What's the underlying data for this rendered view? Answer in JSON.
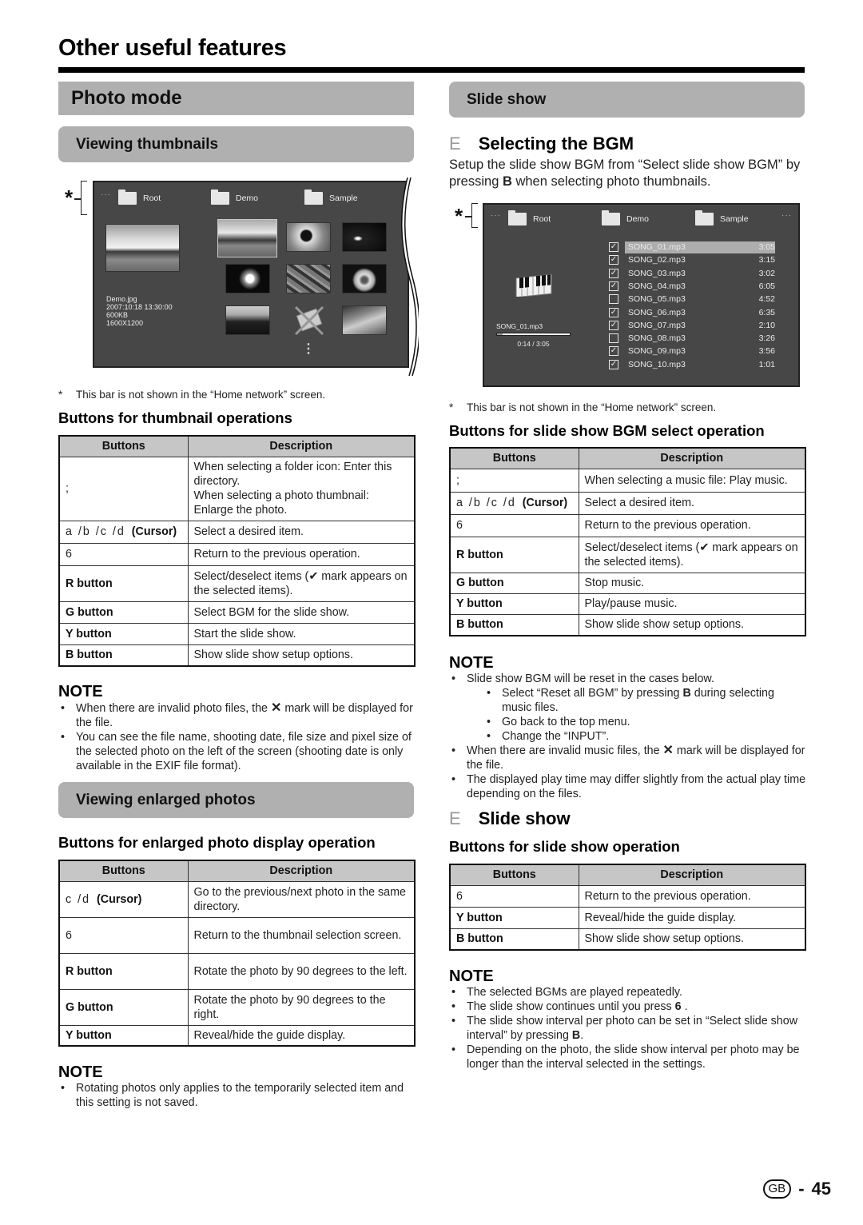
{
  "page": {
    "title": "Other useful features",
    "footer": {
      "region_badge": "GB",
      "separator": "-",
      "page_number": "45"
    }
  },
  "left": {
    "section_title": "Photo mode",
    "thumbnails": {
      "bar_title": "Viewing thumbnails",
      "bracket_mark": "*",
      "screen": {
        "more_indicator": "···",
        "folders": [
          "Root",
          "Demo",
          "Sample"
        ],
        "selected_photo": {
          "file_name": "Demo.jpg",
          "date": "2007:10:18 13:30:00",
          "size": "600KB",
          "pixels": "1600X1200"
        },
        "thumbnails": [
          "landscape",
          "flower-closeup",
          "sunset",
          "daisies",
          "leaves",
          "dandelion",
          "treeline",
          "invalid-file",
          "insect"
        ],
        "scroll_indicator": "⋮"
      },
      "footnote_mark": "*",
      "footnote": "This bar is not shown in the “Home network” screen.",
      "table_heading": "Buttons for thumbnail operations",
      "table": {
        "headers": [
          "Buttons",
          "Description"
        ],
        "rows": [
          {
            "button": ";",
            "button_bold": "",
            "description": "When selecting a folder icon: Enter this directory.\nWhen selecting a photo thumbnail: Enlarge the photo."
          },
          {
            "button": "a /b /c /d",
            "button_bold": "(Cursor)",
            "description": "Select a desired item."
          },
          {
            "button": "6",
            "button_bold": "",
            "description": "Return to the previous operation."
          },
          {
            "button": "",
            "button_bold": "R button",
            "description": "Select/deselect items (✔ mark appears on the selected items)."
          },
          {
            "button": "",
            "button_bold": "G button",
            "description": "Select BGM for the slide show."
          },
          {
            "button": "",
            "button_bold": "Y button",
            "description": "Start the slide show."
          },
          {
            "button": "",
            "button_bold": "B button",
            "description": "Show slide show setup options."
          }
        ]
      },
      "note": {
        "title": "NOTE",
        "items": [
          {
            "before": "When there are invalid photo files, the ",
            "mark": "✕",
            "after": " mark will be displayed for the file."
          },
          {
            "before": "You can see the file name, shooting date, file size and pixel size of the selected photo on the left of the screen (shooting date is only available in the EXIF file format).",
            "mark": "",
            "after": ""
          }
        ]
      }
    },
    "enlarged": {
      "bar_title": "Viewing enlarged photos",
      "table_heading": "Buttons for enlarged photo display operation",
      "table": {
        "headers": [
          "Buttons",
          "Description"
        ],
        "rows": [
          {
            "button": "c /d",
            "button_bold": "(Cursor)",
            "description": "Go to the previous/next photo in the same directory."
          },
          {
            "button": "6",
            "button_bold": "",
            "description": "Return to the thumbnail selection screen."
          },
          {
            "button": "",
            "button_bold": "R button",
            "description": "Rotate the photo by 90 degrees to the left."
          },
          {
            "button": "",
            "button_bold": "G button",
            "description": "Rotate the photo by 90 degrees to the right."
          },
          {
            "button": "",
            "button_bold": "Y button",
            "description": "Reveal/hide the guide display."
          }
        ]
      },
      "note": {
        "title": "NOTE",
        "items": [
          {
            "text": "Rotating photos only applies to the temporarily selected item and this setting is not saved."
          }
        ]
      }
    }
  },
  "right": {
    "section_title": "Slide show",
    "bgm": {
      "marker": "E",
      "heading": "Selecting the BGM",
      "intro_before": "Setup the slide show BGM from “Select slide show BGM” by pressing ",
      "intro_key": "B",
      "intro_after": " when selecting photo thumbnails.",
      "bracket_mark": "*",
      "screen": {
        "more_indicator_left": "···",
        "more_indicator_right": "···",
        "folders": [
          "Root",
          "Demo",
          "Sample"
        ],
        "now_playing": "SONG_01.mp3",
        "progress": {
          "elapsed": "0:14",
          "total": "3:05",
          "label": "0:14 / 3:05",
          "fraction": 0.076
        },
        "songs": [
          {
            "name": "SONG_01.mp3",
            "time": "3:05",
            "checked": true,
            "selected": true
          },
          {
            "name": "SONG_02.mp3",
            "time": "3:15",
            "checked": true,
            "selected": false
          },
          {
            "name": "SONG_03.mp3",
            "time": "3:02",
            "checked": true,
            "selected": false
          },
          {
            "name": "SONG_04.mp3",
            "time": "6:05",
            "checked": true,
            "selected": false
          },
          {
            "name": "SONG_05.mp3",
            "time": "4:52",
            "checked": false,
            "selected": false
          },
          {
            "name": "SONG_06.mp3",
            "time": "6:35",
            "checked": true,
            "selected": false
          },
          {
            "name": "SONG_07.mp3",
            "time": "2:10",
            "checked": true,
            "selected": false
          },
          {
            "name": "SONG_08.mp3",
            "time": "3:26",
            "checked": false,
            "selected": false
          },
          {
            "name": "SONG_09.mp3",
            "time": "3:56",
            "checked": true,
            "selected": false
          },
          {
            "name": "SONG_10.mp3",
            "time": "1:01",
            "checked": true,
            "selected": false
          }
        ],
        "check_glyph": "✓"
      },
      "footnote_mark": "*",
      "footnote": "This bar is not shown in the “Home network” screen.",
      "table_heading": "Buttons for slide show BGM select operation",
      "table": {
        "headers": [
          "Buttons",
          "Description"
        ],
        "rows": [
          {
            "button": ";",
            "button_bold": "",
            "description": "When selecting a music file: Play music."
          },
          {
            "button": "a /b /c /d",
            "button_bold": "(Cursor)",
            "description": "Select a desired item."
          },
          {
            "button": "6",
            "button_bold": "",
            "description": "Return to the previous operation."
          },
          {
            "button": "",
            "button_bold": "R button",
            "description": "Select/deselect items (✔ mark appears on the selected items)."
          },
          {
            "button": "",
            "button_bold": "G button",
            "description": "Stop music."
          },
          {
            "button": "",
            "button_bold": "Y button",
            "description": "Play/pause music."
          },
          {
            "button": "",
            "button_bold": "B button",
            "description": "Show slide show setup options."
          }
        ]
      },
      "note": {
        "title": "NOTE",
        "items": [
          {
            "text": "Slide show BGM will be reset in the cases below.",
            "level": 1
          },
          {
            "before": "Select “Reset all BGM” by pressing ",
            "key": "B",
            "after": " during selecting music files.",
            "level": 2
          },
          {
            "text": "Go back to the top menu.",
            "level": 2
          },
          {
            "text": "Change the “INPUT”.",
            "level": 2
          },
          {
            "before": "When there are invalid music files, the ",
            "mark": "✕",
            "after": " mark will be displayed for the file.",
            "level": 1
          },
          {
            "text": "The displayed play time may differ slightly from the actual play time depending on the files.",
            "level": 1
          }
        ]
      }
    },
    "slideshow": {
      "marker": "E",
      "heading": "Slide show",
      "table_heading": "Buttons for slide show operation",
      "table": {
        "headers": [
          "Buttons",
          "Description"
        ],
        "rows": [
          {
            "button": "6",
            "button_bold": "",
            "description": "Return to the previous operation."
          },
          {
            "button": "",
            "button_bold": "Y button",
            "description": "Reveal/hide the guide display."
          },
          {
            "button": "",
            "button_bold": "B button",
            "description": "Show slide show setup options."
          }
        ]
      },
      "note": {
        "title": "NOTE",
        "items": [
          {
            "text": "The selected BGMs are played repeatedly."
          },
          {
            "before": "The slide show continues until you press ",
            "key": "6",
            "after": "  ."
          },
          {
            "before": "The slide show interval per photo can be set in “Select slide show interval” by pressing ",
            "key": "B",
            "after": "."
          },
          {
            "text": "Depending on the photo, the slide show interval per photo may be longer than the interval selected in the settings."
          }
        ]
      }
    }
  }
}
